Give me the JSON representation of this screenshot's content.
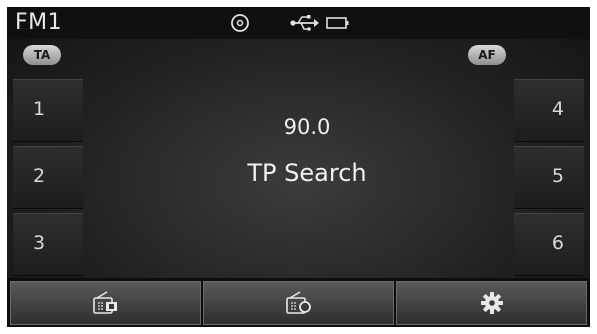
{
  "header": {
    "band": "FM1",
    "icons": [
      "disc-icon",
      "usb-icon",
      "battery-icon"
    ]
  },
  "toggles": {
    "ta_label": "TA",
    "af_label": "AF"
  },
  "presets": {
    "left": [
      "1",
      "2",
      "3"
    ],
    "right": [
      "4",
      "5",
      "6"
    ]
  },
  "tuner": {
    "frequency": "90.0",
    "status": "TP Search"
  },
  "softkeys": {
    "icons": [
      "radio-list-icon",
      "radio-scan-icon",
      "gear-icon"
    ]
  },
  "colors": {
    "background": "#222222",
    "text": "#eeeeee",
    "pill": "#c8c8c8"
  }
}
